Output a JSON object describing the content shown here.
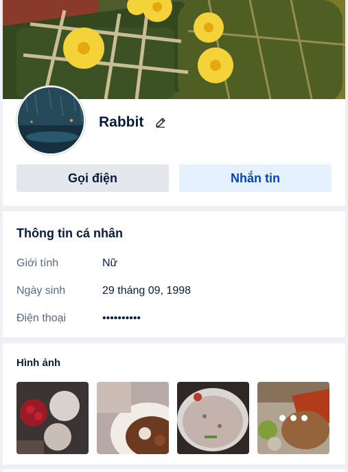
{
  "profile": {
    "name": "Rabbit",
    "call_button": "Gọi điện",
    "message_button": "Nhắn tin"
  },
  "personal_info": {
    "title": "Thông tin cá nhân",
    "rows": [
      {
        "label": "Giới tính",
        "value": "Nữ"
      },
      {
        "label": "Ngày sinh",
        "value": "29 tháng 09, 1998"
      },
      {
        "label": "Điện thoại",
        "value": "••••••••••"
      }
    ]
  },
  "photos": {
    "title": "Hình ảnh",
    "items": [
      "flowers-photo",
      "food-bowl-photo",
      "porridge-photo",
      "rice-dish-photo"
    ],
    "more_icon": "more-dots-icon"
  },
  "icons": {
    "edit": "pencil-icon"
  },
  "colors": {
    "primary_text": "#081b3a",
    "secondary_text": "#5a6981",
    "message_button_bg": "#e5f1ff",
    "message_button_text": "#0047b3",
    "call_button_bg": "#e4e7ec"
  }
}
